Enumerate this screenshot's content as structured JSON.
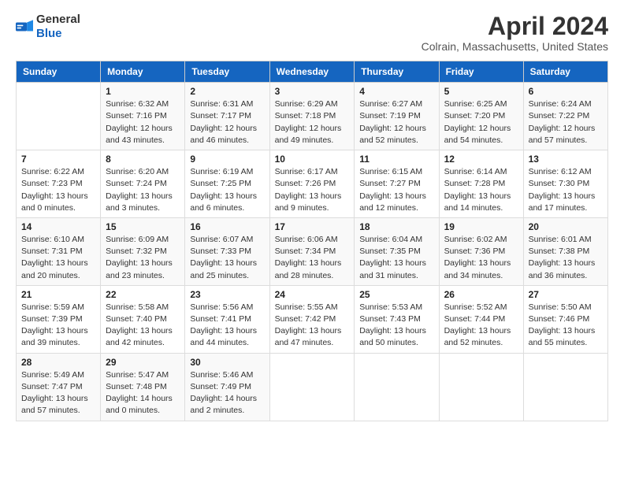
{
  "header": {
    "logo": {
      "general": "General",
      "blue": "Blue"
    },
    "title": "April 2024",
    "subtitle": "Colrain, Massachusetts, United States"
  },
  "calendar": {
    "days_of_week": [
      "Sunday",
      "Monday",
      "Tuesday",
      "Wednesday",
      "Thursday",
      "Friday",
      "Saturday"
    ],
    "weeks": [
      [
        {
          "day": "",
          "info": ""
        },
        {
          "day": "1",
          "info": "Sunrise: 6:32 AM\nSunset: 7:16 PM\nDaylight: 12 hours\nand 43 minutes."
        },
        {
          "day": "2",
          "info": "Sunrise: 6:31 AM\nSunset: 7:17 PM\nDaylight: 12 hours\nand 46 minutes."
        },
        {
          "day": "3",
          "info": "Sunrise: 6:29 AM\nSunset: 7:18 PM\nDaylight: 12 hours\nand 49 minutes."
        },
        {
          "day": "4",
          "info": "Sunrise: 6:27 AM\nSunset: 7:19 PM\nDaylight: 12 hours\nand 52 minutes."
        },
        {
          "day": "5",
          "info": "Sunrise: 6:25 AM\nSunset: 7:20 PM\nDaylight: 12 hours\nand 54 minutes."
        },
        {
          "day": "6",
          "info": "Sunrise: 6:24 AM\nSunset: 7:22 PM\nDaylight: 12 hours\nand 57 minutes."
        }
      ],
      [
        {
          "day": "7",
          "info": "Sunrise: 6:22 AM\nSunset: 7:23 PM\nDaylight: 13 hours\nand 0 minutes."
        },
        {
          "day": "8",
          "info": "Sunrise: 6:20 AM\nSunset: 7:24 PM\nDaylight: 13 hours\nand 3 minutes."
        },
        {
          "day": "9",
          "info": "Sunrise: 6:19 AM\nSunset: 7:25 PM\nDaylight: 13 hours\nand 6 minutes."
        },
        {
          "day": "10",
          "info": "Sunrise: 6:17 AM\nSunset: 7:26 PM\nDaylight: 13 hours\nand 9 minutes."
        },
        {
          "day": "11",
          "info": "Sunrise: 6:15 AM\nSunset: 7:27 PM\nDaylight: 13 hours\nand 12 minutes."
        },
        {
          "day": "12",
          "info": "Sunrise: 6:14 AM\nSunset: 7:28 PM\nDaylight: 13 hours\nand 14 minutes."
        },
        {
          "day": "13",
          "info": "Sunrise: 6:12 AM\nSunset: 7:30 PM\nDaylight: 13 hours\nand 17 minutes."
        }
      ],
      [
        {
          "day": "14",
          "info": "Sunrise: 6:10 AM\nSunset: 7:31 PM\nDaylight: 13 hours\nand 20 minutes."
        },
        {
          "day": "15",
          "info": "Sunrise: 6:09 AM\nSunset: 7:32 PM\nDaylight: 13 hours\nand 23 minutes."
        },
        {
          "day": "16",
          "info": "Sunrise: 6:07 AM\nSunset: 7:33 PM\nDaylight: 13 hours\nand 25 minutes."
        },
        {
          "day": "17",
          "info": "Sunrise: 6:06 AM\nSunset: 7:34 PM\nDaylight: 13 hours\nand 28 minutes."
        },
        {
          "day": "18",
          "info": "Sunrise: 6:04 AM\nSunset: 7:35 PM\nDaylight: 13 hours\nand 31 minutes."
        },
        {
          "day": "19",
          "info": "Sunrise: 6:02 AM\nSunset: 7:36 PM\nDaylight: 13 hours\nand 34 minutes."
        },
        {
          "day": "20",
          "info": "Sunrise: 6:01 AM\nSunset: 7:38 PM\nDaylight: 13 hours\nand 36 minutes."
        }
      ],
      [
        {
          "day": "21",
          "info": "Sunrise: 5:59 AM\nSunset: 7:39 PM\nDaylight: 13 hours\nand 39 minutes."
        },
        {
          "day": "22",
          "info": "Sunrise: 5:58 AM\nSunset: 7:40 PM\nDaylight: 13 hours\nand 42 minutes."
        },
        {
          "day": "23",
          "info": "Sunrise: 5:56 AM\nSunset: 7:41 PM\nDaylight: 13 hours\nand 44 minutes."
        },
        {
          "day": "24",
          "info": "Sunrise: 5:55 AM\nSunset: 7:42 PM\nDaylight: 13 hours\nand 47 minutes."
        },
        {
          "day": "25",
          "info": "Sunrise: 5:53 AM\nSunset: 7:43 PM\nDaylight: 13 hours\nand 50 minutes."
        },
        {
          "day": "26",
          "info": "Sunrise: 5:52 AM\nSunset: 7:44 PM\nDaylight: 13 hours\nand 52 minutes."
        },
        {
          "day": "27",
          "info": "Sunrise: 5:50 AM\nSunset: 7:46 PM\nDaylight: 13 hours\nand 55 minutes."
        }
      ],
      [
        {
          "day": "28",
          "info": "Sunrise: 5:49 AM\nSunset: 7:47 PM\nDaylight: 13 hours\nand 57 minutes."
        },
        {
          "day": "29",
          "info": "Sunrise: 5:47 AM\nSunset: 7:48 PM\nDaylight: 14 hours\nand 0 minutes."
        },
        {
          "day": "30",
          "info": "Sunrise: 5:46 AM\nSunset: 7:49 PM\nDaylight: 14 hours\nand 2 minutes."
        },
        {
          "day": "",
          "info": ""
        },
        {
          "day": "",
          "info": ""
        },
        {
          "day": "",
          "info": ""
        },
        {
          "day": "",
          "info": ""
        }
      ]
    ]
  }
}
